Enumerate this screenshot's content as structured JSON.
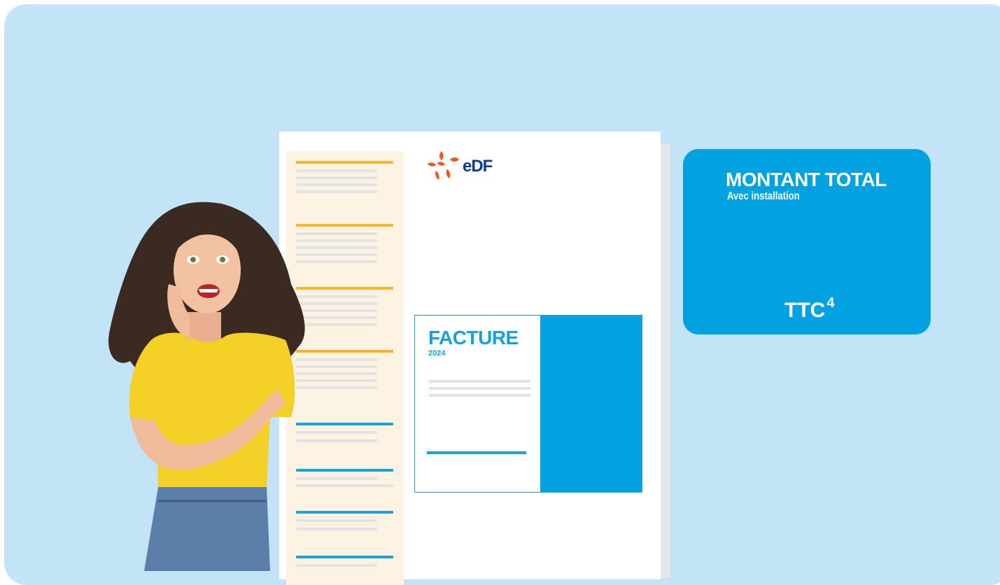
{
  "colors": {
    "background": "#c3e3f7",
    "accent_blue": "#00a3df",
    "accent_yellow": "#f7b52e",
    "edf_orange": "#f05a1f",
    "edf_navy": "#0c3c8c"
  },
  "invoice": {
    "logo": {
      "icon": "edf-logo-icon",
      "text": "eDF"
    },
    "title": "FACTURE",
    "year": "2024"
  },
  "total_panel": {
    "title": "MONTANT TOTAL",
    "subtitle": "Avec installation",
    "ttc_label": "TTC",
    "ttc_note": "4"
  },
  "illustration": {
    "icon": "surprised-woman-illustration"
  }
}
